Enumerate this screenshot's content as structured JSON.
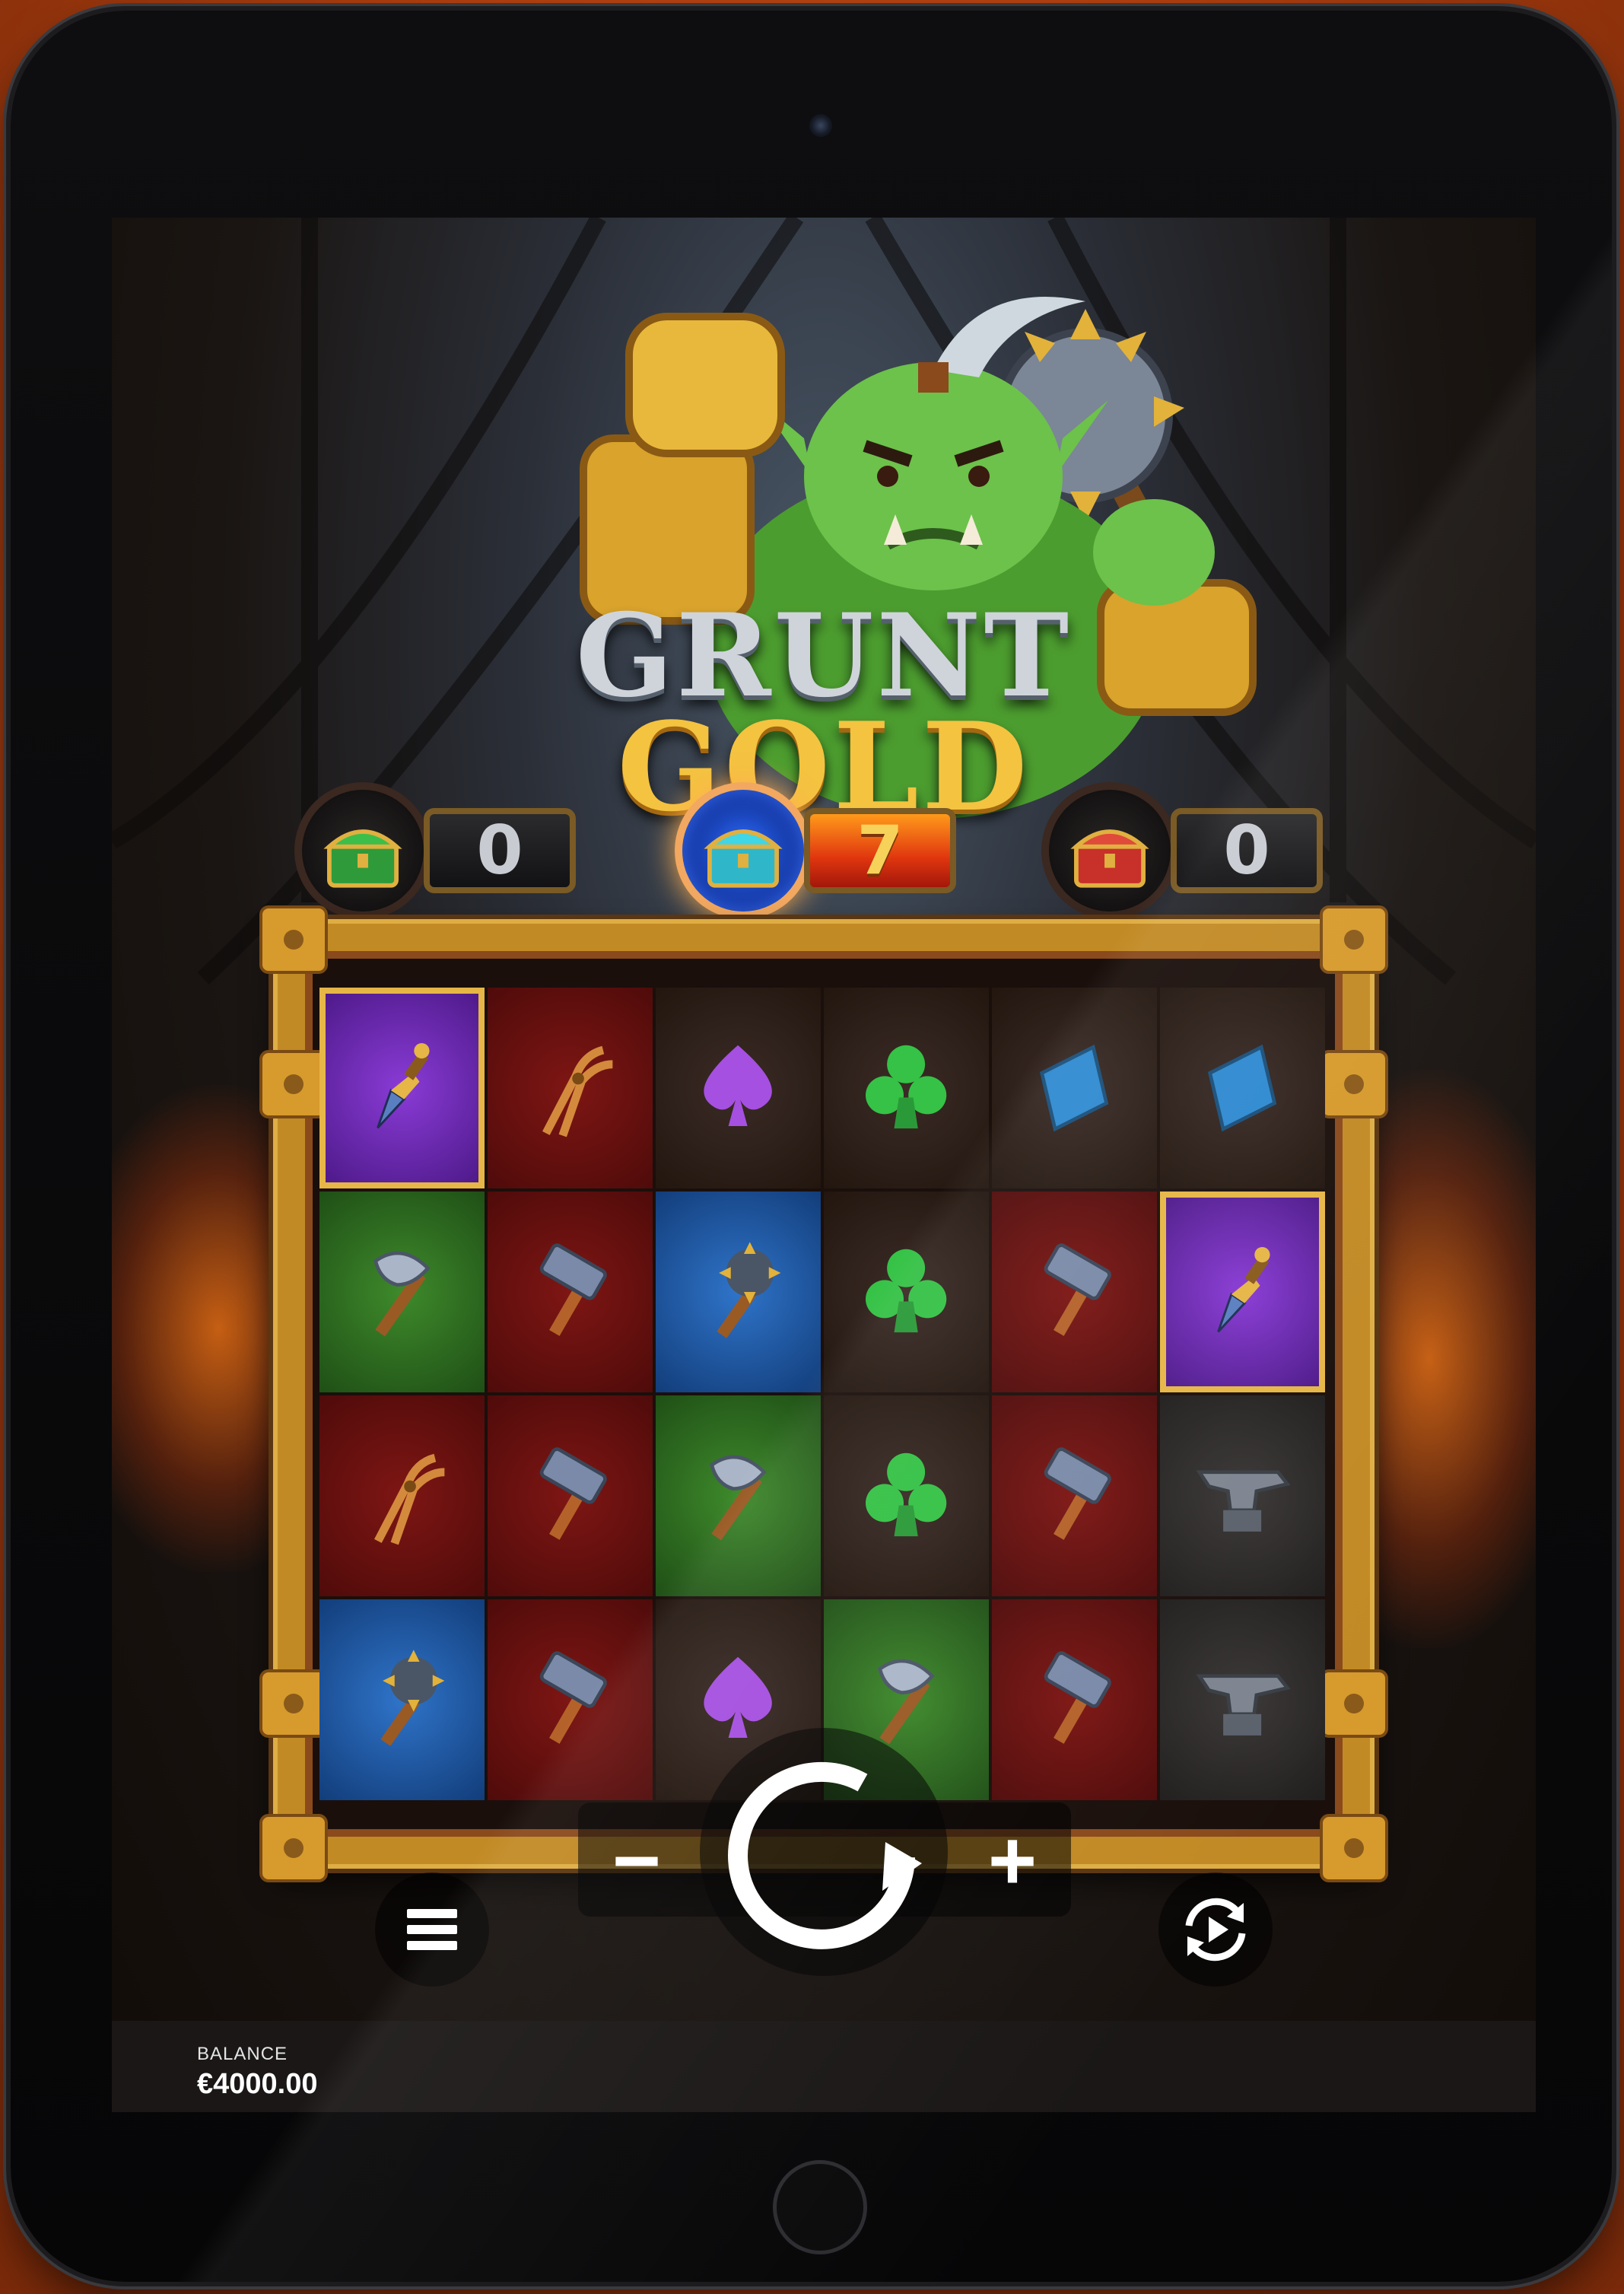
{
  "game": {
    "title_line1": "GRUNT",
    "title_line2": "GOLD"
  },
  "chests": [
    {
      "name": "green-chest",
      "count": "0",
      "active": false
    },
    {
      "name": "blue-chest",
      "count": "7",
      "active": true
    },
    {
      "name": "red-chest",
      "count": "0",
      "active": false
    }
  ],
  "reels": {
    "rows": [
      [
        "dagger",
        "pliers",
        "spade",
        "club",
        "diamond",
        "diamond"
      ],
      [
        "axe",
        "hammer",
        "mace",
        "club",
        "hammer",
        "dagger"
      ],
      [
        "pliers",
        "hammer",
        "axe",
        "club",
        "hammer",
        "anvil"
      ],
      [
        "mace",
        "hammer",
        "spade",
        "axe",
        "hammer",
        "anvil"
      ]
    ]
  },
  "controls": {
    "menu": "menu-icon",
    "spin": "spin-icon",
    "autoplay": "autoplay-icon",
    "bet_minus": "−",
    "bet_plus": "+"
  },
  "balance": {
    "label": "BALANCE",
    "value": "€4000.00"
  },
  "colors": {
    "gold": "#f4c340",
    "frame": "#c28a25",
    "background": "#b2400f"
  }
}
